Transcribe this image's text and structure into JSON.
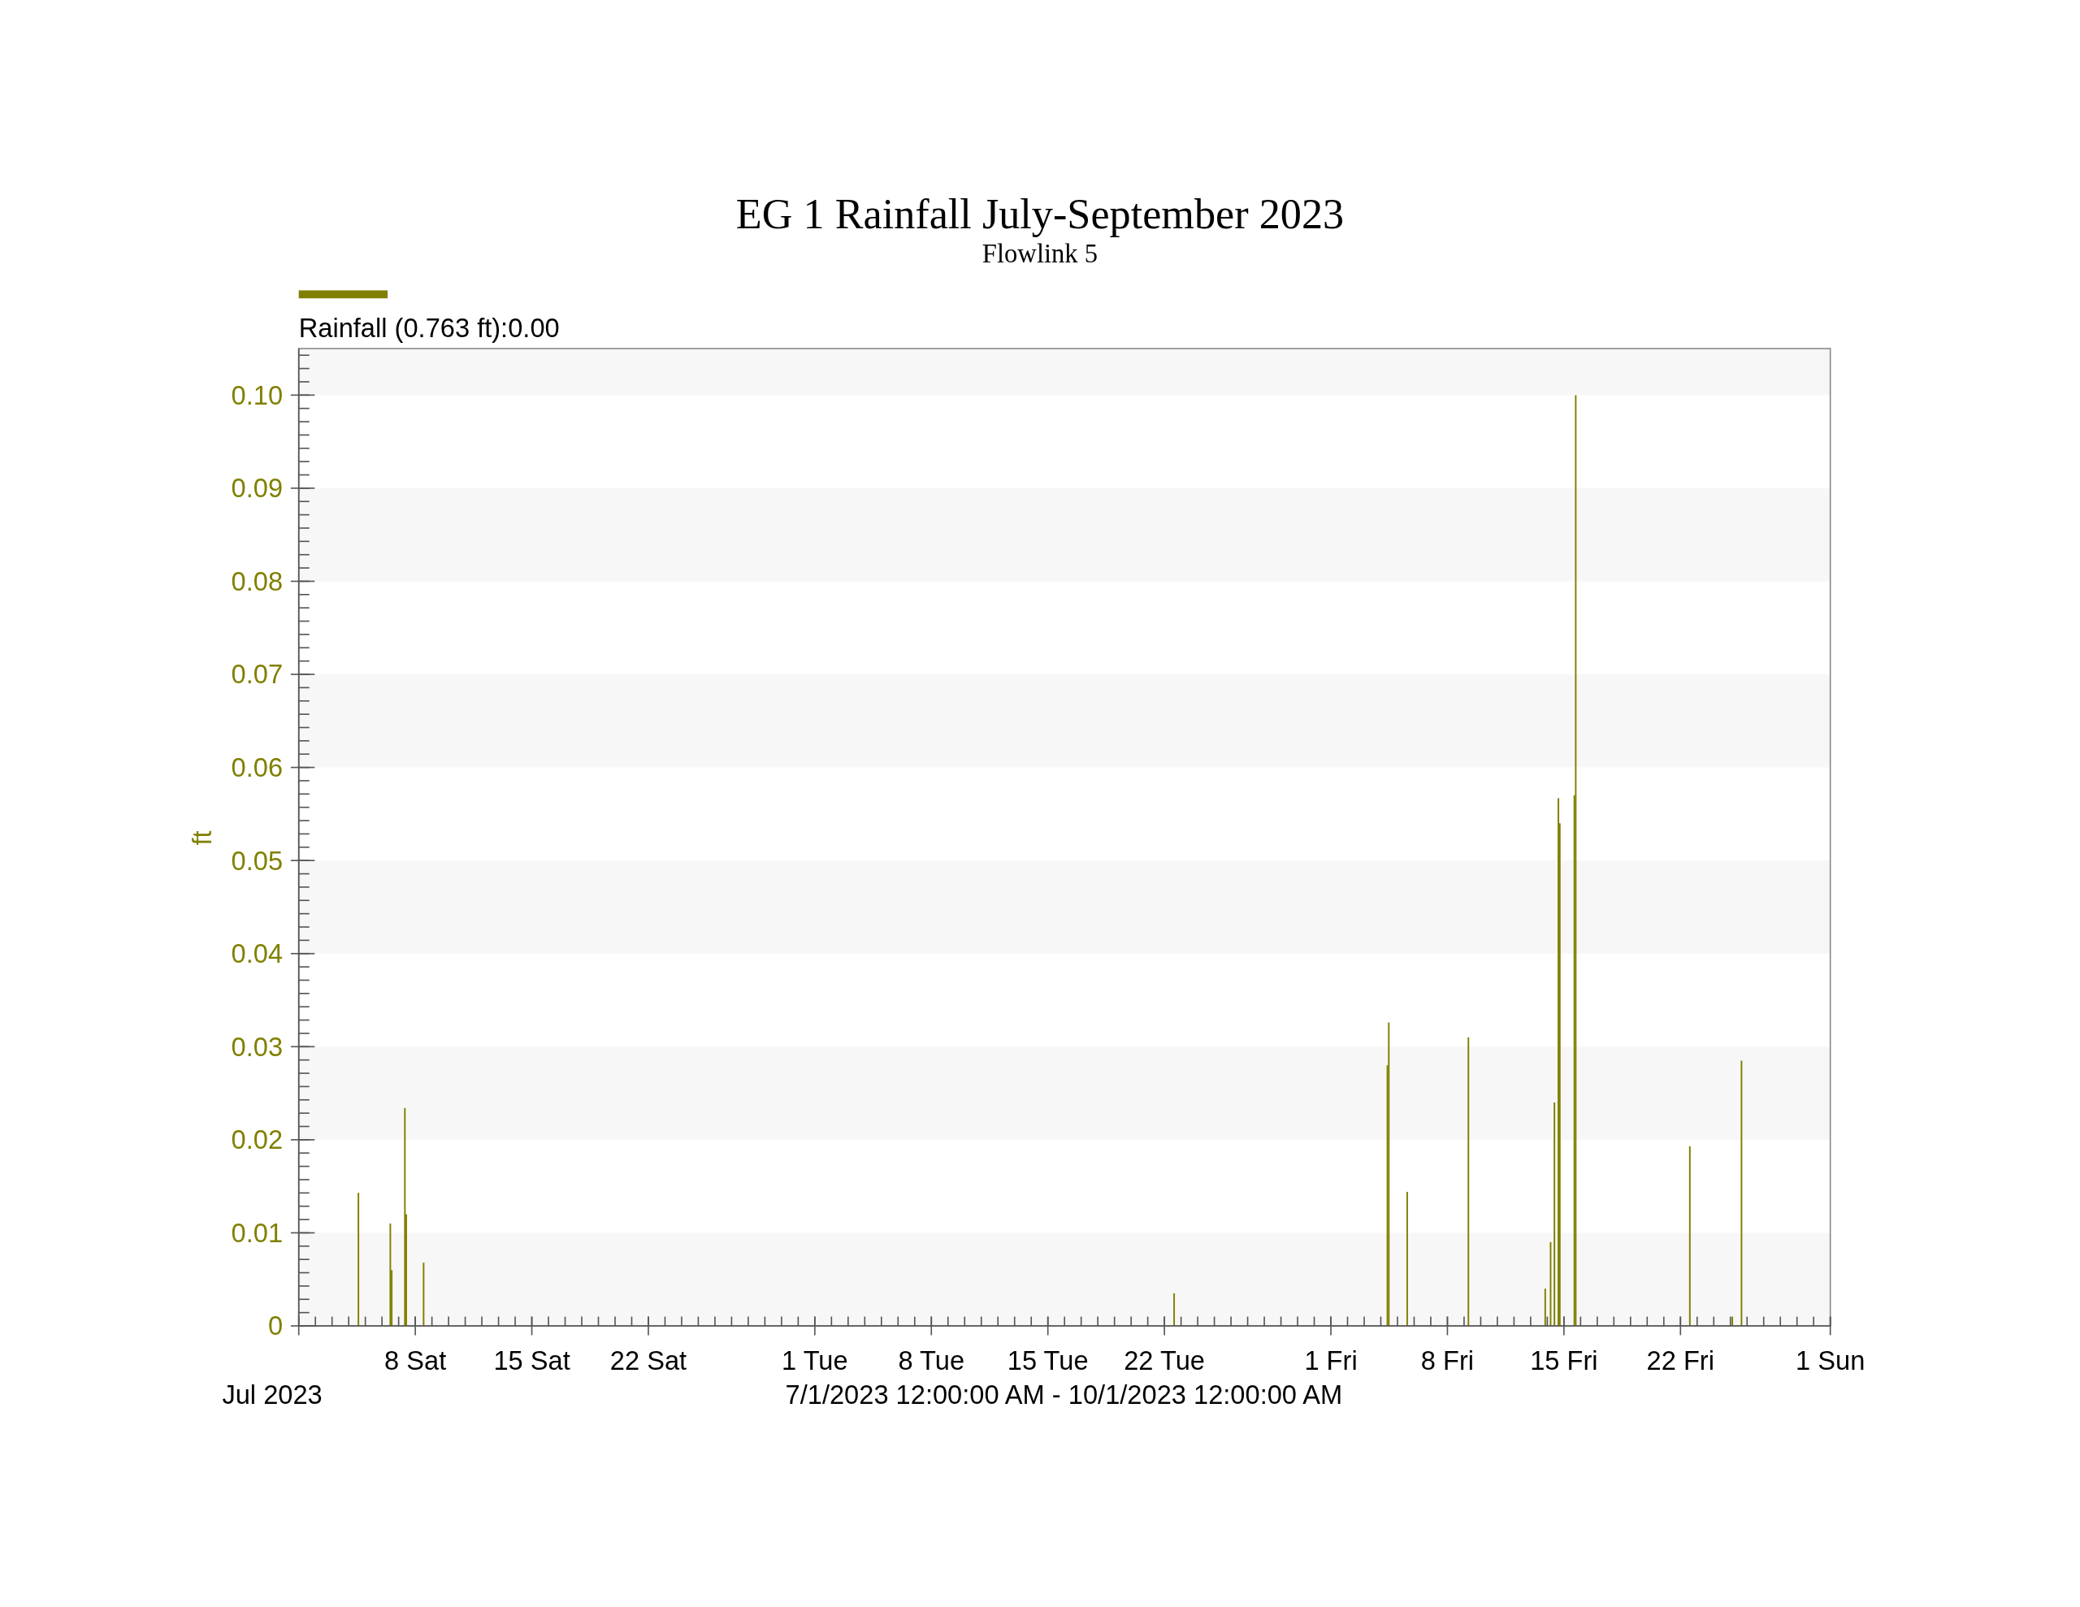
{
  "chart": {
    "subtitle": "Flowlink 5",
    "legend": {
      "label": "Rainfall (0.763 ft):0.00",
      "color": "#808000"
    },
    "period_label": "Jul 2023",
    "range_label": "7/1/2023 12:00:00 AM - 10/1/2023 12:00:00 AM",
    "chart_data": {
      "type": "bar",
      "title": "EG 1 Rainfall July-September 2023",
      "ylabel": "ft",
      "x": [
        "2023-07-04T14:00",
        "2023-07-06T12:00",
        "2023-07-06T14:00",
        "2023-07-07T09:00",
        "2023-07-07T11:00",
        "2023-07-08T12:00",
        "2023-08-22T14:00",
        "2023-09-04T09:30",
        "2023-09-04T11:30",
        "2023-09-05T14:00",
        "2023-09-09T06:15",
        "2023-09-13T21:00",
        "2023-09-14T04:45",
        "2023-09-14T10:15",
        "2023-09-14T16:00",
        "2023-09-14T18:00",
        "2023-09-15T15:00",
        "2023-09-15T17:00",
        "2023-09-22T13:30",
        "2023-09-25T02:45",
        "2023-09-25T16:00"
      ],
      "series": [
        {
          "color": "#808000",
          "values": [
            0.0143,
            0.011,
            0.006,
            0.0234,
            0.012,
            0.0068,
            0.0035,
            0.028,
            0.0326,
            0.0144,
            0.031,
            0.004,
            0.009,
            0.024,
            0.0567,
            0.054,
            0.057,
            0.1,
            0.0193,
            0.001,
            0.0285
          ]
        }
      ],
      "xlim": [
        "2023-07-01T00:00",
        "2023-10-01T00:00"
      ],
      "ylim": [
        0,
        0.105
      ],
      "xticks": [
        {
          "value": "2023-07-08T00:00",
          "label": "8 Sat"
        },
        {
          "value": "2023-07-15T00:00",
          "label": "15 Sat"
        },
        {
          "value": "2023-07-22T00:00",
          "label": "22 Sat"
        },
        {
          "value": "2023-08-01T00:00",
          "label": "1 Tue"
        },
        {
          "value": "2023-08-08T00:00",
          "label": "8 Tue"
        },
        {
          "value": "2023-08-15T00:00",
          "label": "15 Tue"
        },
        {
          "value": "2023-08-22T00:00",
          "label": "22 Tue"
        },
        {
          "value": "2023-09-01T00:00",
          "label": "1 Fri"
        },
        {
          "value": "2023-09-08T00:00",
          "label": "8 Fri"
        },
        {
          "value": "2023-09-15T00:00",
          "label": "15 Fri"
        },
        {
          "value": "2023-09-22T00:00",
          "label": "22 Fri"
        },
        {
          "value": "2023-10-01T00:00",
          "label": "1 Sun"
        }
      ],
      "yticks": [
        {
          "value": 0,
          "label": "0"
        },
        {
          "value": 0.01,
          "label": "0.01"
        },
        {
          "value": 0.02,
          "label": "0.02"
        },
        {
          "value": 0.03,
          "label": "0.03"
        },
        {
          "value": 0.04,
          "label": "0.04"
        },
        {
          "value": 0.05,
          "label": "0.05"
        },
        {
          "value": 0.06,
          "label": "0.06"
        },
        {
          "value": 0.07,
          "label": "0.07"
        },
        {
          "value": 0.08,
          "label": "0.08"
        },
        {
          "value": 0.09,
          "label": "0.09"
        },
        {
          "value": 0.1,
          "label": "0.10"
        }
      ]
    }
  }
}
